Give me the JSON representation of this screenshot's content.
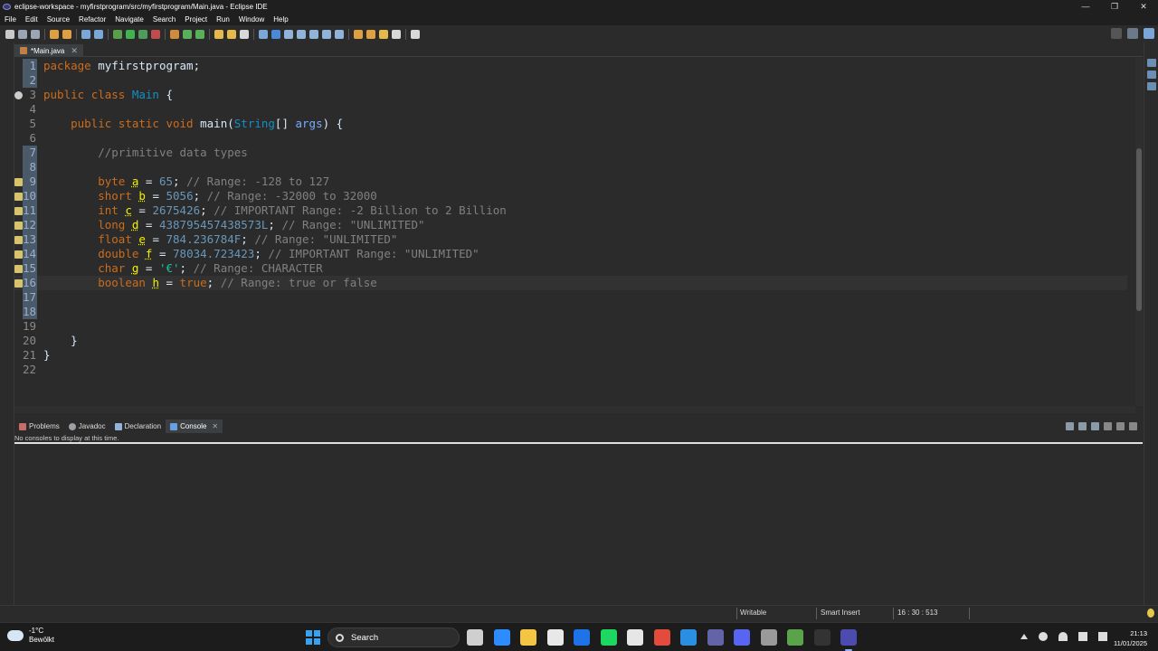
{
  "window": {
    "title": "eclipse-workspace - myfirstprogram/src/myfirstprogram/Main.java - Eclipse IDE",
    "controls": [
      "—",
      "❐",
      "✕"
    ]
  },
  "menu": [
    "File",
    "Edit",
    "Source",
    "Refactor",
    "Navigate",
    "Search",
    "Project",
    "Run",
    "Window",
    "Help"
  ],
  "editor": {
    "tab_label": "*Main.java",
    "lines": [
      {
        "n": "1",
        "html": "<span class='kw'>package</span> myfirstprogram;"
      },
      {
        "n": "2",
        "html": ""
      },
      {
        "n": "3",
        "html": "<span class='kw'>public</span> <span class='kw'>class</span> <span class='type'>Main</span> {"
      },
      {
        "n": "4",
        "html": ""
      },
      {
        "n": "5",
        "html": "    <span class='kw'>public</span> <span class='kw'>static</span> <span class='kw'>void</span> <span class='ident'>main</span>(<span class='type'>String</span>[] <span class='field'>args</span>) {"
      },
      {
        "n": "6",
        "html": ""
      },
      {
        "n": "7",
        "html": "        <span class='cmt'>//primitive data types</span>"
      },
      {
        "n": "8",
        "html": ""
      },
      {
        "n": "9",
        "html": "        <span class='kw'>byte</span> <span class='var'>a</span> = <span class='num'>65</span>; <span class='cmt'>// Range: -128 to 127</span>"
      },
      {
        "n": "10",
        "html": "        <span class='kw'>short</span> <span class='var'>b</span> = <span class='num'>5056</span>; <span class='cmt'>// Range: -32000 to 32000</span>"
      },
      {
        "n": "11",
        "html": "        <span class='kw'>int</span> <span class='var'>c</span> = <span class='num'>2675426</span>; <span class='cmt'>// IMPORTANT Range: -2 Billion to 2 Billion</span>"
      },
      {
        "n": "12",
        "html": "        <span class='kw'>long</span> <span class='var'>d</span> = <span class='num'>438795457438573L</span>; <span class='cmt'>// Range: \"UNLIMITED\"</span>"
      },
      {
        "n": "13",
        "html": "        <span class='kw'>float</span> <span class='var'>e</span> = <span class='num'>784.236784F</span>; <span class='cmt'>// Range: \"UNLIMITED\"</span>"
      },
      {
        "n": "14",
        "html": "        <span class='kw'>double</span> <span class='var'>f</span> = <span class='num'>78034.723423</span>; <span class='cmt'>// IMPORTANT Range: \"UNLIMITED\"</span>"
      },
      {
        "n": "15",
        "html": "        <span class='kw'>char</span> <span class='var'>g</span> = <span class='str'>'€'</span>; <span class='cmt'>// Range: CHARACTER</span>"
      },
      {
        "n": "16",
        "html": "        <span class='kw'>boolean</span> <span class='var'>h</span> = <span class='kw'>true</span>; <span class='cmt'>// Range: true or false</span>"
      },
      {
        "n": "17",
        "html": ""
      },
      {
        "n": "18",
        "html": ""
      },
      {
        "n": "19",
        "html": ""
      },
      {
        "n": "20",
        "html": "    }"
      },
      {
        "n": "21",
        "html": "}"
      },
      {
        "n": "22",
        "html": ""
      }
    ]
  },
  "console": {
    "tabs": [
      {
        "label": "Problems",
        "color": "#c76b6b"
      },
      {
        "label": "Javadoc",
        "color": "#9aa0a6"
      },
      {
        "label": "Declaration",
        "color": "#8fb3d9"
      },
      {
        "label": "Console",
        "color": "#6aa0e0"
      }
    ],
    "active_tab": "Console",
    "message": "No consoles to display at this time."
  },
  "status": {
    "writable": "Writable",
    "insert_mode": "Smart Insert",
    "position": "16 : 30 : 513"
  },
  "taskbar": {
    "temperature": "-1°C",
    "weather": "Bewölkt",
    "search_placeholder": "Search",
    "time": "21:13",
    "date": "11/01/2025",
    "apps": [
      {
        "name": "task-view",
        "color": "#cfcfcf"
      },
      {
        "name": "zoom",
        "color": "#2d8cff"
      },
      {
        "name": "file-explorer",
        "color": "#f4c542"
      },
      {
        "name": "store",
        "color": "#e8e8e8"
      },
      {
        "name": "app-blue",
        "color": "#1e73e8"
      },
      {
        "name": "spotify",
        "color": "#1ed760"
      },
      {
        "name": "notepad",
        "color": "#e6e6e6"
      },
      {
        "name": "chrome",
        "color": "#e34b3c"
      },
      {
        "name": "vscode",
        "color": "#2a8fe0"
      },
      {
        "name": "teams",
        "color": "#6264a7"
      },
      {
        "name": "discord",
        "color": "#5865f2"
      },
      {
        "name": "settings",
        "color": "#9a9a9a"
      },
      {
        "name": "minecraft",
        "color": "#5aa34b"
      },
      {
        "name": "terminal",
        "color": "#333333"
      },
      {
        "name": "eclipse",
        "color": "#4b4bb0"
      }
    ]
  }
}
